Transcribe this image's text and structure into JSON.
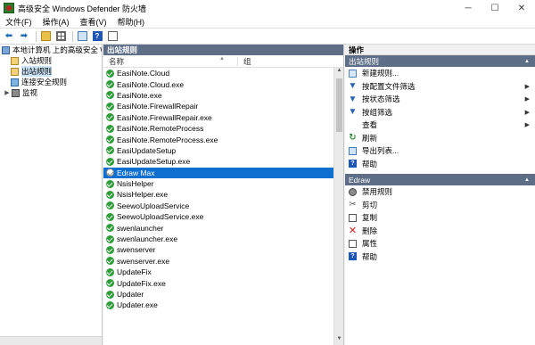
{
  "window": {
    "title": "高级安全 Windows Defender 防火墙"
  },
  "title_buttons": {
    "minimize": "─",
    "maximize": "☐",
    "close": "✕"
  },
  "menubar": [
    "文件(F)",
    "操作(A)",
    "查看(V)",
    "帮助(H)"
  ],
  "toolbar": {
    "icons": [
      "back-arrow-icon",
      "forward-arrow-icon",
      "folder-icon",
      "grid-icon",
      "export-icon",
      "help-icon",
      "properties-icon"
    ],
    "glyphs": {
      "back": "⬅",
      "forward": "➡",
      "help": "?"
    }
  },
  "tree": {
    "root": "本地计算机 上的高级安全 Windows",
    "items": [
      "入站规则",
      "出站规则",
      "连接安全规则",
      "监视"
    ]
  },
  "middle": {
    "header": "出站规则",
    "columns": {
      "name": "名称",
      "group": "组"
    },
    "rules": [
      {
        "name": "EasiNote.Cloud",
        "enabled": true
      },
      {
        "name": "EasiNote.Cloud.exe",
        "enabled": true
      },
      {
        "name": "EasiNote.exe",
        "enabled": true
      },
      {
        "name": "EasiNote.FirewallRepair",
        "enabled": true
      },
      {
        "name": "EasiNote.FirewallRepair.exe",
        "enabled": true
      },
      {
        "name": "EasiNote.RemoteProcess",
        "enabled": true
      },
      {
        "name": "EasiNote.RemoteProcess.exe",
        "enabled": true
      },
      {
        "name": "EasiUpdateSetup",
        "enabled": true
      },
      {
        "name": "EasiUpdateSetup.exe",
        "enabled": true
      },
      {
        "name": "Edraw Max",
        "enabled": false,
        "selected": true
      },
      {
        "name": "NsisHelper",
        "enabled": true
      },
      {
        "name": "NsisHelper.exe",
        "enabled": true
      },
      {
        "name": "SeewoUploadService",
        "enabled": true
      },
      {
        "name": "SeewoUploadService.exe",
        "enabled": true
      },
      {
        "name": "swenlauncher",
        "enabled": true
      },
      {
        "name": "swenlauncher.exe",
        "enabled": true
      },
      {
        "name": "swenserver",
        "enabled": true
      },
      {
        "name": "swenserver.exe",
        "enabled": true
      },
      {
        "name": "UpdateFix",
        "enabled": true
      },
      {
        "name": "UpdateFix.exe",
        "enabled": true
      },
      {
        "name": "Updater",
        "enabled": true
      },
      {
        "name": "Updater.exe",
        "enabled": true
      }
    ]
  },
  "actions": {
    "header": "操作",
    "section1": {
      "title": "出站规则",
      "items": [
        {
          "label": "新建规则...",
          "icon": "new-rule-icon",
          "arrow": false
        },
        {
          "label": "按配置文件筛选",
          "icon": "filter-icon",
          "arrow": true
        },
        {
          "label": "按状态筛选",
          "icon": "filter-icon",
          "arrow": true
        },
        {
          "label": "按组筛选",
          "icon": "filter-icon",
          "arrow": true
        },
        {
          "label": "查看",
          "icon": "",
          "arrow": true
        },
        {
          "label": "刷新",
          "icon": "refresh-icon",
          "arrow": false
        },
        {
          "label": "导出列表...",
          "icon": "export-icon",
          "arrow": false
        },
        {
          "label": "帮助",
          "icon": "help-icon",
          "arrow": false
        }
      ]
    },
    "section2": {
      "title": "Edraw",
      "items": [
        {
          "label": "禁用规则",
          "icon": "disable-icon"
        },
        {
          "label": "剪切",
          "icon": "cut-icon"
        },
        {
          "label": "复制",
          "icon": "copy-icon"
        },
        {
          "label": "删除",
          "icon": "delete-icon"
        },
        {
          "label": "属性",
          "icon": "properties-icon"
        },
        {
          "label": "帮助",
          "icon": "help-icon"
        }
      ]
    }
  },
  "colors": {
    "selected_row": "#0d6fd0",
    "section_header": "#5d6e86",
    "enabled_check": "#2f9d3a"
  }
}
